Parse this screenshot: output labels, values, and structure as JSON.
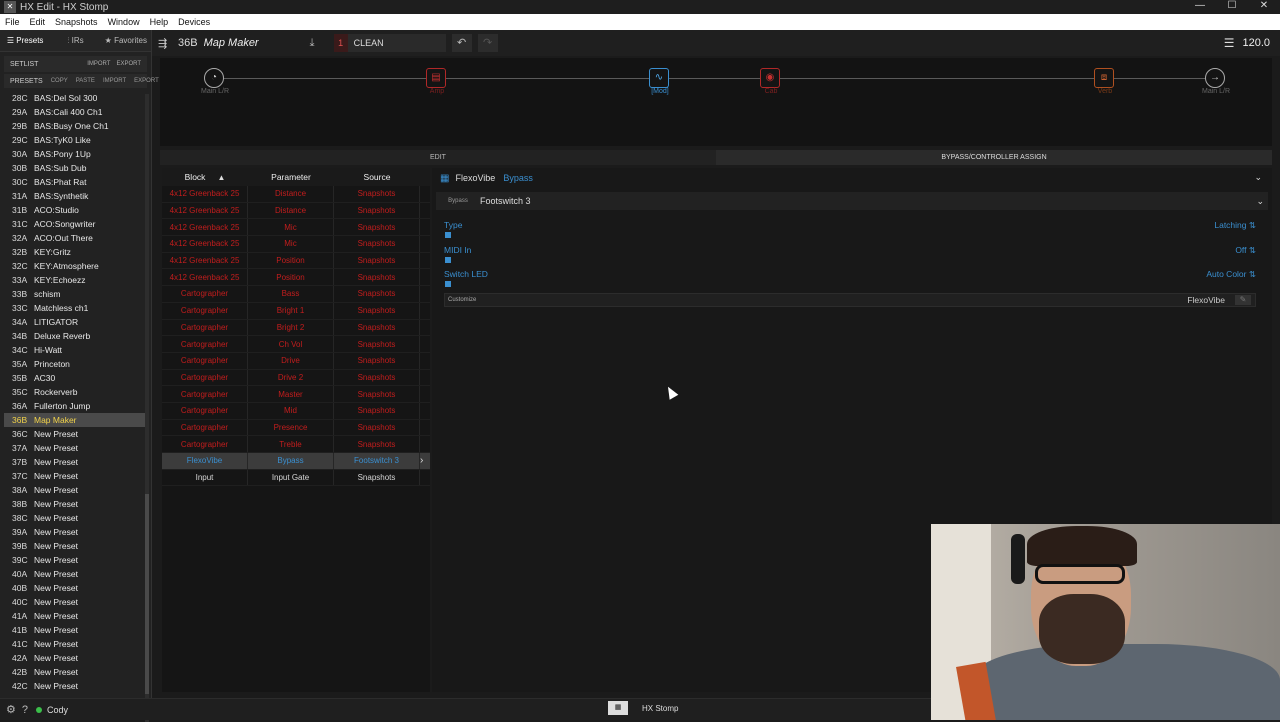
{
  "window": {
    "title": "HX Edit - HX Stomp",
    "min": "—",
    "max": "☐",
    "close": "✕"
  },
  "menu": [
    "File",
    "Edit",
    "Snapshots",
    "Window",
    "Help",
    "Devices"
  ],
  "nav_tabs": [
    "Presets",
    "IRs",
    "Favorites"
  ],
  "setlist": {
    "label": "SETLIST",
    "import": "IMPORT",
    "export": "EXPORT"
  },
  "presets_bar": {
    "label": "PRESETS",
    "copy": "COPY",
    "paste": "PASTE",
    "import": "IMPORT",
    "export": "EXPORT"
  },
  "presets": [
    {
      "num": "28C",
      "name": "BAS:Del Sol 300"
    },
    {
      "num": "29A",
      "name": "BAS:Cali 400 Ch1"
    },
    {
      "num": "29B",
      "name": "BAS:Busy One Ch1"
    },
    {
      "num": "29C",
      "name": "BAS:TyK0 Like"
    },
    {
      "num": "30A",
      "name": "BAS:Pony 1Up"
    },
    {
      "num": "30B",
      "name": "BAS:Sub Dub"
    },
    {
      "num": "30C",
      "name": "BAS:Phat Rat"
    },
    {
      "num": "31A",
      "name": "BAS:Synthetik"
    },
    {
      "num": "31B",
      "name": "ACO:Studio"
    },
    {
      "num": "31C",
      "name": "ACO:Songwriter"
    },
    {
      "num": "32A",
      "name": "ACO:Out There"
    },
    {
      "num": "32B",
      "name": "KEY:Gritz"
    },
    {
      "num": "32C",
      "name": "KEY:Atmosphere"
    },
    {
      "num": "33A",
      "name": "KEY:Echoezz"
    },
    {
      "num": "33B",
      "name": "schism"
    },
    {
      "num": "33C",
      "name": "Matchless ch1"
    },
    {
      "num": "34A",
      "name": "LITIGATOR"
    },
    {
      "num": "34B",
      "name": "Deluxe Reverb"
    },
    {
      "num": "34C",
      "name": "Hi-Watt"
    },
    {
      "num": "35A",
      "name": "Princeton"
    },
    {
      "num": "35B",
      "name": "AC30"
    },
    {
      "num": "35C",
      "name": "Rockerverb"
    },
    {
      "num": "36A",
      "name": "Fullerton Jump"
    },
    {
      "num": "36B",
      "name": "Map Maker"
    },
    {
      "num": "36C",
      "name": "New Preset"
    },
    {
      "num": "37A",
      "name": "New Preset"
    },
    {
      "num": "37B",
      "name": "New Preset"
    },
    {
      "num": "37C",
      "name": "New Preset"
    },
    {
      "num": "38A",
      "name": "New Preset"
    },
    {
      "num": "38B",
      "name": "New Preset"
    },
    {
      "num": "38C",
      "name": "New Preset"
    },
    {
      "num": "39A",
      "name": "New Preset"
    },
    {
      "num": "39B",
      "name": "New Preset"
    },
    {
      "num": "39C",
      "name": "New Preset"
    },
    {
      "num": "40A",
      "name": "New Preset"
    },
    {
      "num": "40B",
      "name": "New Preset"
    },
    {
      "num": "40C",
      "name": "New Preset"
    },
    {
      "num": "41A",
      "name": "New Preset"
    },
    {
      "num": "41B",
      "name": "New Preset"
    },
    {
      "num": "41C",
      "name": "New Preset"
    },
    {
      "num": "42A",
      "name": "New Preset"
    },
    {
      "num": "42B",
      "name": "New Preset"
    },
    {
      "num": "42C",
      "name": "New Preset"
    }
  ],
  "selected_preset_index": 23,
  "toolbar": {
    "preset_num": "36B",
    "preset_name": "Map Maker",
    "snapshot_num": "1",
    "snapshot_name": "CLEAN",
    "tempo": "120.0"
  },
  "chain": {
    "nodes": [
      {
        "label": "Main L/R",
        "icon": "input-icon"
      },
      {
        "label": "Amp",
        "icon": "amp-icon"
      },
      {
        "label": "[Mod]",
        "icon": "mod-icon"
      },
      {
        "label": "Cab",
        "icon": "cab-icon"
      },
      {
        "label": "Verb",
        "icon": "verb-icon"
      },
      {
        "label": "Main L/R",
        "icon": "output-icon"
      }
    ]
  },
  "edit_tabs": {
    "edit": "EDIT",
    "bypass": "BYPASS/CONTROLLER ASSIGN"
  },
  "table": {
    "headers": [
      "Block",
      "Parameter",
      "Source"
    ],
    "rows": [
      [
        "4x12 Greenback 25",
        "Distance",
        "Snapshots"
      ],
      [
        "4x12 Greenback 25",
        "Distance",
        "Snapshots"
      ],
      [
        "4x12 Greenback 25",
        "Mic",
        "Snapshots"
      ],
      [
        "4x12 Greenback 25",
        "Mic",
        "Snapshots"
      ],
      [
        "4x12 Greenback 25",
        "Position",
        "Snapshots"
      ],
      [
        "4x12 Greenback 25",
        "Position",
        "Snapshots"
      ],
      [
        "Cartographer",
        "Bass",
        "Snapshots"
      ],
      [
        "Cartographer",
        "Bright 1",
        "Snapshots"
      ],
      [
        "Cartographer",
        "Bright 2",
        "Snapshots"
      ],
      [
        "Cartographer",
        "Ch Vol",
        "Snapshots"
      ],
      [
        "Cartographer",
        "Drive",
        "Snapshots"
      ],
      [
        "Cartographer",
        "Drive 2",
        "Snapshots"
      ],
      [
        "Cartographer",
        "Master",
        "Snapshots"
      ],
      [
        "Cartographer",
        "Mid",
        "Snapshots"
      ],
      [
        "Cartographer",
        "Presence",
        "Snapshots"
      ],
      [
        "Cartographer",
        "Treble",
        "Snapshots"
      ],
      [
        "FlexoVibe",
        "Bypass",
        "Footswitch 3"
      ],
      [
        "Input",
        "Input Gate",
        "Snapshots"
      ]
    ],
    "selected_row": 16
  },
  "detail": {
    "block": "FlexoVibe",
    "param": "Bypass",
    "bypass_label": "Bypass",
    "bypass_value": "Footswitch 3",
    "settings": [
      {
        "label": "Type",
        "value": "Latching"
      },
      {
        "label": "MIDI In",
        "value": "Off"
      },
      {
        "label": "Switch LED",
        "value": "Auto Color"
      }
    ],
    "customize_label": "Customize",
    "customize_value": "FlexoVibe"
  },
  "status": {
    "user": "Cody",
    "device": "HX Stomp"
  }
}
